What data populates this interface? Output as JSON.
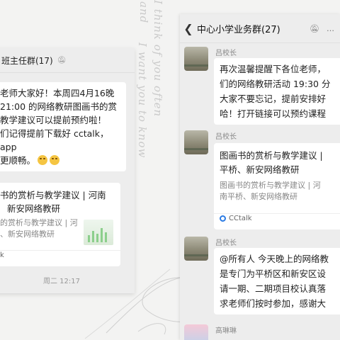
{
  "decor": {
    "script_line1": "I think of you often",
    "script_line2": "I want you to know",
    "script_line3": "and"
  },
  "left_chat": {
    "title": "班主任群(17)",
    "mute_icon": "bell-mute-icon",
    "message_lines": [
      "老师大家好！本周四4月16晚",
      "21:00 的网络教研图画书的赏",
      "教学建议可以提前预约啦！",
      "们记得提前下载好 cctalk，app",
      "更顺畅。"
    ],
    "card": {
      "title_lines": [
        "书的赏析与教学建议 | 河南",
        "新安网络教研"
      ],
      "desc_lines": [
        "的赏析与教学建议 | 河",
        "、新安网络教研"
      ],
      "source": "k"
    },
    "timestamp": "周二 12:17"
  },
  "right_chat": {
    "back_icon": "chevron-left-icon",
    "title": "中心小学业务群(27)",
    "mute_icon": "bell-mute-icon",
    "more_icon": "more-icon",
    "messages": [
      {
        "sender": "吕校长",
        "lines": [
          "再次温馨提醒下各位老师，",
          "们的网络教研活动 19:30 分",
          "大家不要忘记，提前安排好",
          "哈！打开链接可以预约课程"
        ]
      },
      {
        "sender": "吕校长",
        "card_title_lines": [
          "图画书的赏析与教学建议 |",
          "平桥、新安网络教研"
        ],
        "card_desc_lines": [
          "图画书的赏析与教学建议 | 河",
          "南平桥、新安网络教研"
        ],
        "card_source": "CCtalk"
      },
      {
        "sender": "吕校长",
        "lines": [
          "@所有人 今天晚上的网络教",
          "是专门为平桥区和新安区设",
          "请一期、二期项目校认真落",
          "求老师们按时参加，感谢大"
        ]
      },
      {
        "sender": "高琳琳"
      }
    ]
  }
}
